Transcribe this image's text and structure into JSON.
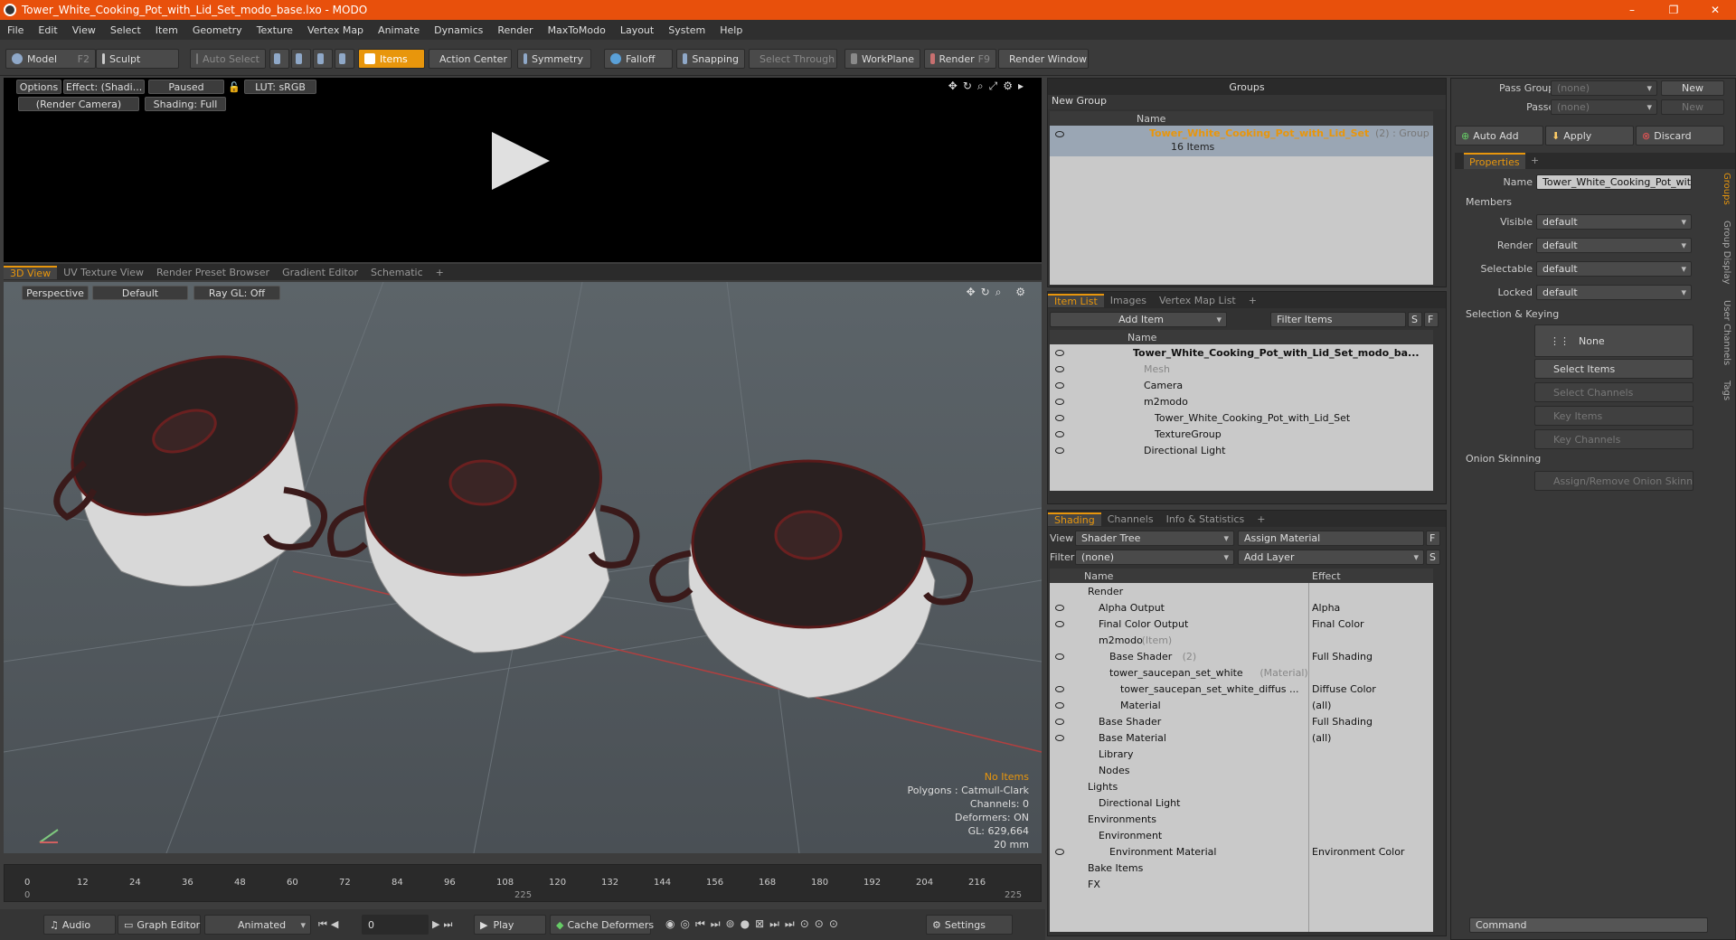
{
  "title": "Tower_White_Cooking_Pot_with_Lid_Set_modo_base.lxo - MODO",
  "window_controls": {
    "minimize": "–",
    "maximize": "❐",
    "close": "✕"
  },
  "menu": [
    "File",
    "Edit",
    "View",
    "Select",
    "Item",
    "Geometry",
    "Texture",
    "Vertex Map",
    "Animate",
    "Dynamics",
    "Render",
    "MaxToModo",
    "Layout",
    "System",
    "Help"
  ],
  "toolbar": {
    "model": "Model",
    "model_key": "F2",
    "sculpt": "Sculpt",
    "auto_select": "Auto Select",
    "items": "Items",
    "action_center": "Action Center",
    "symmetry": "Symmetry",
    "falloff": "Falloff",
    "snapping": "Snapping",
    "select_through": "Select Through",
    "workplane": "WorkPlane",
    "render": "Render",
    "render_key": "F9",
    "render_window": "Render Window"
  },
  "preview": {
    "options": "Options",
    "effect": "Effect: (Shadi...",
    "paused": "Paused",
    "lut": "LUT: sRGB",
    "camera": "(Render Camera)",
    "shading": "Shading: Full"
  },
  "view_tabs": [
    "3D View",
    "UV Texture View",
    "Render Preset Browser",
    "Gradient Editor",
    "Schematic",
    "+"
  ],
  "viewport": {
    "perspective": "Perspective",
    "default": "Default",
    "raygl": "Ray GL: Off"
  },
  "hud": {
    "no_items": "No Items",
    "polygons": "Polygons : Catmull-Clark",
    "channels": "Channels: 0",
    "deformers": "Deformers: ON",
    "gl": "GL: 629,664",
    "scale": "20 mm"
  },
  "timeline": {
    "ticks": [
      "0",
      "12",
      "24",
      "36",
      "48",
      "60",
      "72",
      "84",
      "96",
      "108",
      "120",
      "132",
      "144",
      "156",
      "168",
      "180",
      "192",
      "204",
      "216"
    ],
    "start": "0",
    "mid": "225",
    "end": "225"
  },
  "bottom": {
    "audio": "Audio",
    "graph_editor": "Graph Editor",
    "animated": "Animated",
    "frame": "0",
    "play": "Play",
    "cache": "Cache Deformers",
    "settings": "Settings"
  },
  "groups": {
    "title": "Groups",
    "new_group": "New Group",
    "col_name": "Name",
    "item_name": "Tower_White_Cooking_Pot_with_Lid_Set",
    "item_count": "(2) : Group",
    "item_sub": "16 Items"
  },
  "item_list": {
    "tabs": [
      "Item List",
      "Images",
      "Vertex Map List",
      "+"
    ],
    "add_item": "Add Item",
    "filter": "Filter Items",
    "s": "S",
    "f": "F",
    "col_name": "Name",
    "rows": [
      {
        "label": "Tower_White_Cooking_Pot_with_Lid_Set_modo_ba...",
        "indent": 0,
        "bold": true
      },
      {
        "label": "Mesh",
        "indent": 1,
        "dim": true
      },
      {
        "label": "Camera",
        "indent": 1
      },
      {
        "label": "m2modo",
        "indent": 1
      },
      {
        "label": "Tower_White_Cooking_Pot_with_Lid_Set",
        "indent": 2
      },
      {
        "label": "TextureGroup",
        "indent": 2
      },
      {
        "label": "Directional Light",
        "indent": 1
      }
    ]
  },
  "shading": {
    "tabs": [
      "Shading",
      "Channels",
      "Info & Statistics",
      "+"
    ],
    "view_label": "View",
    "view_value": "Shader Tree",
    "assign": "Assign Material",
    "filter_label": "Filter",
    "filter_value": "(none)",
    "add_layer": "Add Layer",
    "f": "F",
    "s": "S",
    "col_name": "Name",
    "col_effect": "Effect",
    "rows": [
      {
        "label": "Render",
        "indent": 0,
        "effect": "",
        "extra": ""
      },
      {
        "label": "Alpha Output",
        "indent": 1,
        "effect": "Alpha",
        "extra": ""
      },
      {
        "label": "Final Color Output",
        "indent": 1,
        "effect": "Final Color",
        "extra": ""
      },
      {
        "label": "m2modo",
        "indent": 1,
        "effect": "",
        "extra": "(Item)"
      },
      {
        "label": "Base Shader",
        "indent": 2,
        "effect": "Full Shading",
        "extra": "(2)"
      },
      {
        "label": "tower_saucepan_set_white",
        "indent": 2,
        "effect": "",
        "extra": "(Material)"
      },
      {
        "label": "tower_saucepan_set_white_diffus ...",
        "indent": 3,
        "effect": "Diffuse Color",
        "extra": ""
      },
      {
        "label": "Material",
        "indent": 3,
        "effect": "(all)",
        "extra": ""
      },
      {
        "label": "Base Shader",
        "indent": 1,
        "effect": "Full Shading",
        "extra": ""
      },
      {
        "label": "Base Material",
        "indent": 1,
        "effect": "(all)",
        "extra": ""
      },
      {
        "label": "Library",
        "indent": 1,
        "effect": "",
        "extra": ""
      },
      {
        "label": "Nodes",
        "indent": 1,
        "effect": "",
        "extra": ""
      },
      {
        "label": "Lights",
        "indent": 0,
        "effect": "",
        "extra": ""
      },
      {
        "label": "Directional Light",
        "indent": 1,
        "effect": "",
        "extra": ""
      },
      {
        "label": "Environments",
        "indent": 0,
        "effect": "",
        "extra": ""
      },
      {
        "label": "Environment",
        "indent": 1,
        "effect": "",
        "extra": ""
      },
      {
        "label": "Environment Material",
        "indent": 2,
        "effect": "Environment Color",
        "extra": ""
      },
      {
        "label": "Bake Items",
        "indent": 0,
        "effect": "",
        "extra": ""
      },
      {
        "label": "FX",
        "indent": 0,
        "effect": "",
        "extra": ""
      }
    ]
  },
  "properties": {
    "pass_groups": "Pass Groups",
    "none1": "(none)",
    "new1": "New",
    "passes": "Passes",
    "none2": "(none)",
    "new2": "New",
    "auto_add": "Auto Add",
    "apply": "Apply",
    "discard": "Discard",
    "tab": "Properties",
    "plus": "+",
    "name_label": "Name",
    "name_value": "Tower_White_Cooking_Pot_with_L",
    "members": "Members",
    "visible": "Visible",
    "render": "Render",
    "selectable": "Selectable",
    "locked": "Locked",
    "default": "default",
    "selection_keying": "Selection & Keying",
    "none": "None",
    "select_items": "Select Items",
    "select_channels": "Select Channels",
    "key_items": "Key Items",
    "key_channels": "Key Channels",
    "onion": "Onion Skinning",
    "assign_onion": "Assign/Remove Onion Skinning",
    "side_tabs": [
      "Groups",
      "Group Display",
      "User Channels",
      "Tags"
    ],
    "command": "Command"
  }
}
